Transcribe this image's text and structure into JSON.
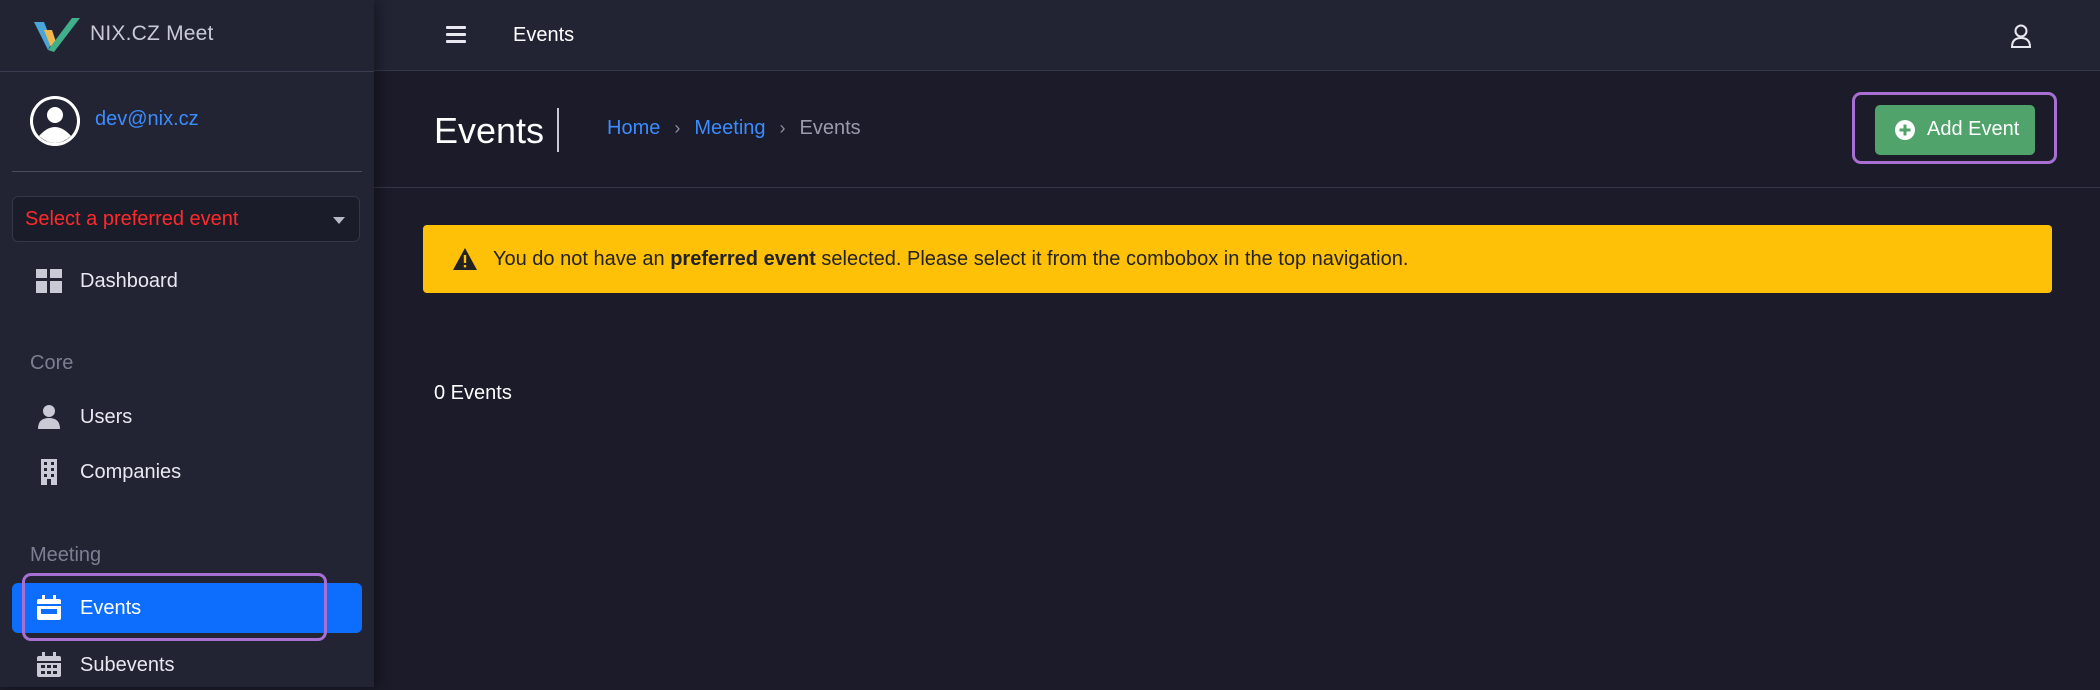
{
  "brand": {
    "name": "NIX.CZ Meet"
  },
  "user": {
    "email": "dev@nix.cz"
  },
  "preferred_event": {
    "placeholder": "Select a preferred event",
    "color": "#ff2a2a"
  },
  "sidebar": {
    "dashboard": {
      "label": "Dashboard",
      "icon": "dashboard-icon"
    },
    "sections": [
      {
        "heading": "Core",
        "items": [
          {
            "label": "Users",
            "icon": "user-icon"
          },
          {
            "label": "Companies",
            "icon": "building-icon"
          }
        ]
      },
      {
        "heading": "Meeting",
        "items": [
          {
            "label": "Events",
            "icon": "calendar-icon",
            "active": true
          },
          {
            "label": "Subevents",
            "icon": "calendar-grid-icon"
          }
        ]
      }
    ]
  },
  "topbar": {
    "title": "Events"
  },
  "page": {
    "title": "Events",
    "breadcrumb": [
      {
        "label": "Home",
        "link": true
      },
      {
        "label": "Meeting",
        "link": true
      },
      {
        "label": "Events",
        "link": false
      }
    ],
    "add_button": {
      "label": "Add Event"
    }
  },
  "alert": {
    "prefix": "You do not have an ",
    "bold": "preferred event",
    "suffix": " selected. Please select it from the combobox in the top navigation."
  },
  "events_count": "0 Events",
  "colors": {
    "accent": "#0d6efd",
    "link": "#3b8cff",
    "success": "#4fa36b",
    "warning": "#ffc107",
    "highlight": "#a66fd1"
  }
}
